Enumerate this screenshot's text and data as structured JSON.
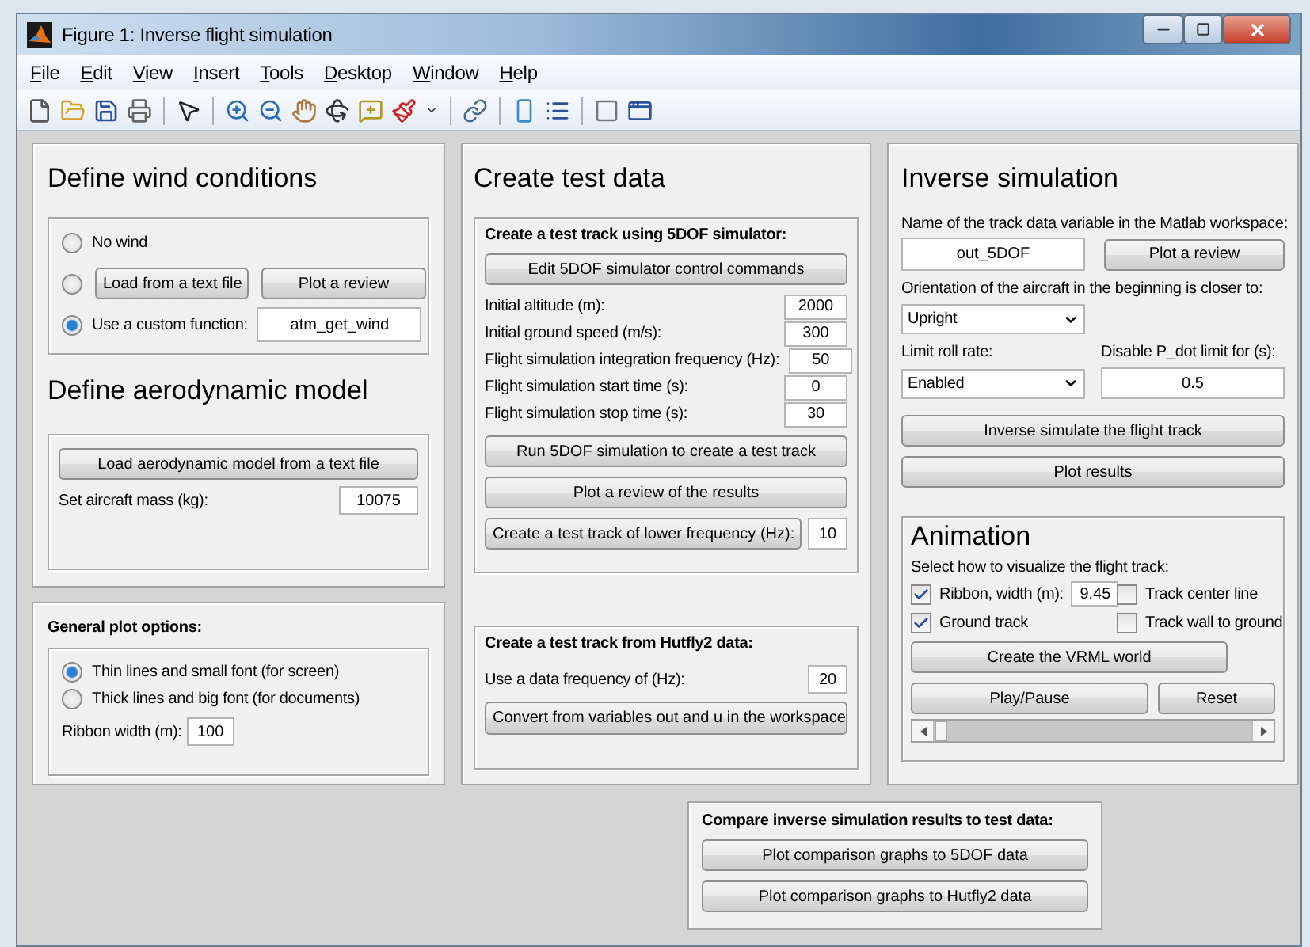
{
  "window": {
    "title": "Figure 1: Inverse flight simulation"
  },
  "menu": [
    "File",
    "Edit",
    "View",
    "Insert",
    "Tools",
    "Desktop",
    "Window",
    "Help"
  ],
  "wind": {
    "title": "Define wind conditions",
    "options": [
      {
        "kind": "label",
        "selected": false,
        "label": "No wind"
      },
      {
        "kind": "buttons",
        "selected": false,
        "buttons": [
          "Load from a text file",
          "Plot a review"
        ]
      },
      {
        "kind": "field",
        "selected": true,
        "label": "Use a custom function:",
        "value": "atm_get_wind"
      }
    ]
  },
  "aero": {
    "title": "Define aerodynamic model",
    "button": "Load aerodynamic model from a text file",
    "mass_label": "Set aircraft mass (kg):",
    "mass_value": "10075"
  },
  "plot_options": {
    "title": "General plot options:",
    "options": [
      {
        "label": "Thin lines and small font (for screen)",
        "selected": true
      },
      {
        "label": "Thick lines and big font (for documents)",
        "selected": false
      }
    ],
    "ribbon_label": "Ribbon width (m):",
    "ribbon_value": "100"
  },
  "test_data": {
    "title": "Create test data",
    "simulator": {
      "title": "Create a test track using 5DOF simulator:",
      "edit_button": "Edit 5DOF simulator control commands",
      "fields": [
        {
          "label": "Initial altitude (m):",
          "value": "2000"
        },
        {
          "label": "Initial ground speed (m/s):",
          "value": "300"
        },
        {
          "label": "Flight simulation integration frequency (Hz):",
          "value": "50"
        },
        {
          "label": "Flight simulation start time (s):",
          "value": "0"
        },
        {
          "label": "Flight simulation stop time (s):",
          "value": "30"
        }
      ],
      "run_button": "Run 5DOF simulation to create a test track",
      "review_button": "Plot a review of the results",
      "lower_button": "Create a test track of lower frequency (Hz):",
      "lower_value": "10"
    },
    "hutfly": {
      "title": "Create a test track from Hutfly2 data:",
      "label": "Use a data frequency of (Hz):",
      "value": "20",
      "button": "Convert from variables out and u in the workspace"
    }
  },
  "inverse": {
    "title": "Inverse simulation",
    "variable_label": "Name of the track data variable in the Matlab workspace:",
    "variable_value": "out_5DOF",
    "review_button": "Plot a review",
    "orientation_label": "Orientation of the aircraft in the beginning is closer to:",
    "orientation_value": "Upright",
    "roll_label": "Limit roll rate:",
    "roll_value": "Enabled",
    "pdot_label": "Disable P_dot limit for (s):",
    "pdot_value": "0.5",
    "simulate_button": "Inverse simulate the flight track",
    "plot_button": "Plot results"
  },
  "animation": {
    "title": "Animation",
    "prompt": "Select how to visualize the flight track:",
    "options": [
      {
        "label": "Ribbon, width (m):",
        "checked": true,
        "value": "9.45"
      },
      {
        "label": "Track center line",
        "checked": false
      },
      {
        "label": "Ground track",
        "checked": true
      },
      {
        "label": "Track wall to ground",
        "checked": false
      }
    ],
    "vrml_button": "Create the VRML world",
    "play_button": "Play/Pause",
    "reset_button": "Reset",
    "slider": {
      "level": 0
    }
  },
  "compare": {
    "title": "Compare inverse simulation results to test data:",
    "buttons": [
      "Plot comparison graphs to 5DOF data",
      "Plot comparison graphs to Hutfly2 data"
    ]
  }
}
